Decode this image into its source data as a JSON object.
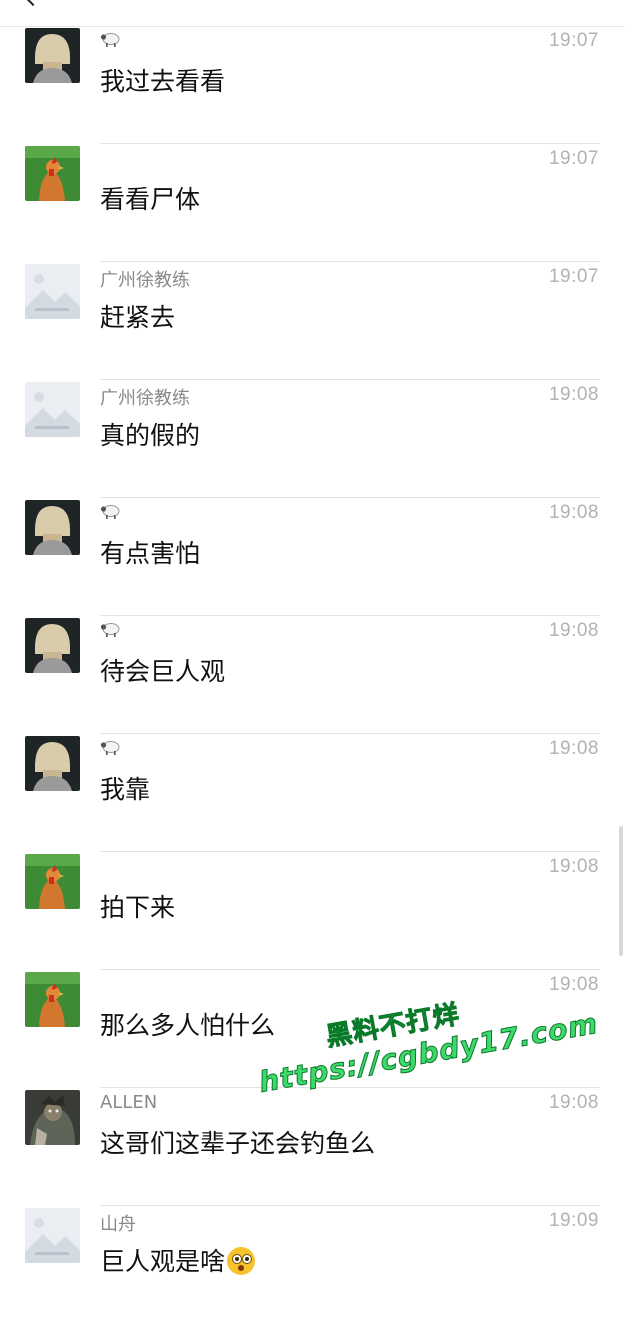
{
  "messages": [
    {
      "sender": "",
      "sender_icon": "sheep-icon",
      "avatar": "blonde-bob",
      "time": "19:07",
      "text": "我过去看看"
    },
    {
      "sender": "",
      "sender_icon": "",
      "avatar": "chicken",
      "time": "19:07",
      "text": "看看尸体"
    },
    {
      "sender": "广州徐教练",
      "sender_icon": "",
      "avatar": "placeholder-image",
      "time": "19:07",
      "text": "赶紧去"
    },
    {
      "sender": "广州徐教练",
      "sender_icon": "",
      "avatar": "placeholder-image",
      "time": "19:08",
      "text": "真的假的"
    },
    {
      "sender": "",
      "sender_icon": "sheep-icon",
      "avatar": "blonde-bob",
      "time": "19:08",
      "text": "有点害怕"
    },
    {
      "sender": "",
      "sender_icon": "sheep-icon",
      "avatar": "blonde-bob",
      "time": "19:08",
      "text": "待会巨人观"
    },
    {
      "sender": "",
      "sender_icon": "sheep-icon",
      "avatar": "blonde-bob",
      "time": "19:08",
      "text": "我靠"
    },
    {
      "sender": "",
      "sender_icon": "",
      "avatar": "chicken",
      "time": "19:08",
      "text": "拍下来"
    },
    {
      "sender": "",
      "sender_icon": "",
      "avatar": "chicken",
      "time": "19:08",
      "text": "那么多人怕什么"
    },
    {
      "sender": "ALLEN",
      "sender_icon": "",
      "avatar": "dark-figure",
      "time": "19:08",
      "text": "这哥们这辈子还会钓鱼么"
    },
    {
      "sender": "山舟",
      "sender_icon": "",
      "avatar": "placeholder-image",
      "time": "19:09",
      "text": "巨人观是啥",
      "trailing_icon": "flushed-face-emoji-icon"
    }
  ],
  "watermark": {
    "line1": "黑料不打烊",
    "line2": "https://cgbdy17.com"
  },
  "colors": {
    "background": "#ffffff",
    "time": "#b2b2b2",
    "sender": "#8a8a8a",
    "divider": "#e3e3e3",
    "watermark": "#3fd86b"
  }
}
